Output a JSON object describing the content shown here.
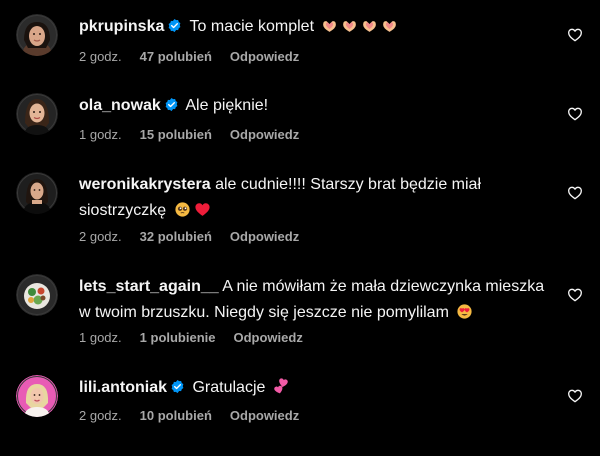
{
  "comments": [
    {
      "username": "pkrupinska",
      "verified": true,
      "text": "To macie komplet",
      "emojis": [
        "heart-hands-emoji",
        "heart-hands-emoji",
        "heart-hands-emoji",
        "heart-hands-emoji"
      ],
      "time": "2 godz.",
      "likes": "47 polubień",
      "reply": "Odpowiedz"
    },
    {
      "username": "ola_nowak",
      "verified": true,
      "text": "Ale pięknie!",
      "emojis": [],
      "time": "1 godz.",
      "likes": "15 polubień",
      "reply": "Odpowiedz"
    },
    {
      "username": "weronikakrystera",
      "verified": false,
      "text": "ale cudnie!!!! Starszy brat będzie miał siostrzyczkę",
      "emojis": [
        "pleading-face-emoji",
        "red-heart-emoji"
      ],
      "time": "2 godz.",
      "likes": "32 polubień",
      "reply": "Odpowiedz"
    },
    {
      "username": "lets_start_again__",
      "verified": false,
      "text": "A nie mówiłam że mała dziewczynka mieszka w twoim brzuszku. Niegdy się jeszcze nie pomylilam",
      "emojis": [
        "heart-eyes-emoji"
      ],
      "time": "1 godz.",
      "likes": "1 polubienie",
      "reply": "Odpowiedz"
    },
    {
      "username": "lili.antoniak",
      "verified": true,
      "text": "Gratulacje",
      "emojis": [
        "two-hearts-emoji"
      ],
      "time": "2 godz.",
      "likes": "10 polubień",
      "reply": "Odpowiedz"
    }
  ],
  "colors": {
    "background": "#000000",
    "text": "#f5f5f5",
    "meta": "#a8a8a8",
    "verified": "#0095f6",
    "avatar_ring": "#3a3a3a"
  },
  "icons": {
    "like": "heart-outline-icon",
    "verified": "verified-badge-icon"
  }
}
